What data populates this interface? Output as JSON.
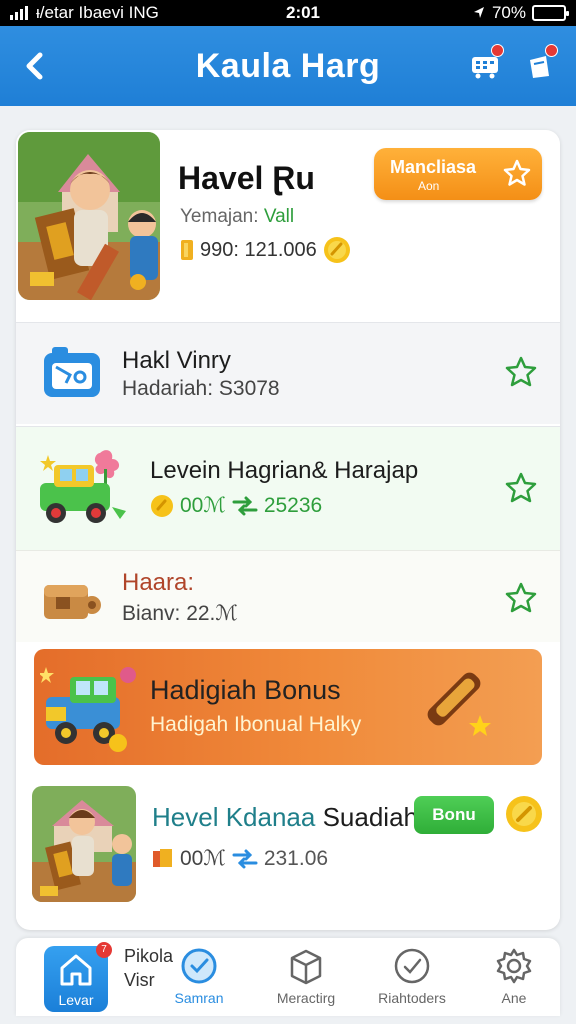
{
  "status_bar": {
    "carrier": "ᵻ/etar Ibaevi ING",
    "time": "2:01",
    "battery": "70%",
    "battery_level": 0.7
  },
  "header": {
    "title": "Kaula Harg",
    "back_icon": "chevron-left-icon",
    "icons": [
      "cart-icon",
      "gift-icon"
    ]
  },
  "profile": {
    "name": "Havel Ɽu",
    "subtitle_prefix": "Yemajan: ",
    "subtitle_value": "Vall",
    "stat": "990: 121.006",
    "manage_button": {
      "label": "Mancliasa",
      "sub": "Aon"
    }
  },
  "items": [
    {
      "title": "Hakl Vinry",
      "meta": "Hadariah: S3078"
    },
    {
      "title": "Levein Hagrian& Harajap",
      "meta_a": "00ℳ",
      "meta_b": "25236"
    },
    {
      "title": "Haara:",
      "meta": "Bianv: 22.ℳ"
    }
  ],
  "bonus": {
    "title": "Hadigiah Bonus",
    "subtitle": "Hadigah Ibonual Halky"
  },
  "featured": {
    "title_teal": "Hevel Kdanaa",
    "title_dark": " Suadiah",
    "pill": "Bonu",
    "meta_a": "00ℳ",
    "meta_b": "231.06"
  },
  "popup": {
    "line1": "Pikola",
    "line2": "Visr"
  },
  "bottom_nav": [
    {
      "label": "Levar",
      "icon": "home-icon",
      "badge": "7"
    },
    {
      "label": "Samran",
      "icon": "clock-icon"
    },
    {
      "label": "Meractirg",
      "icon": "box-icon"
    },
    {
      "label": "Riahtoders",
      "icon": "check-icon"
    },
    {
      "label": "Ane",
      "icon": "gear-icon"
    }
  ],
  "colors": {
    "header_blue": "#1f7fd6",
    "accent_orange": "#f48f16",
    "bonus_orange": "#e46d2a",
    "green": "#2fae38"
  }
}
